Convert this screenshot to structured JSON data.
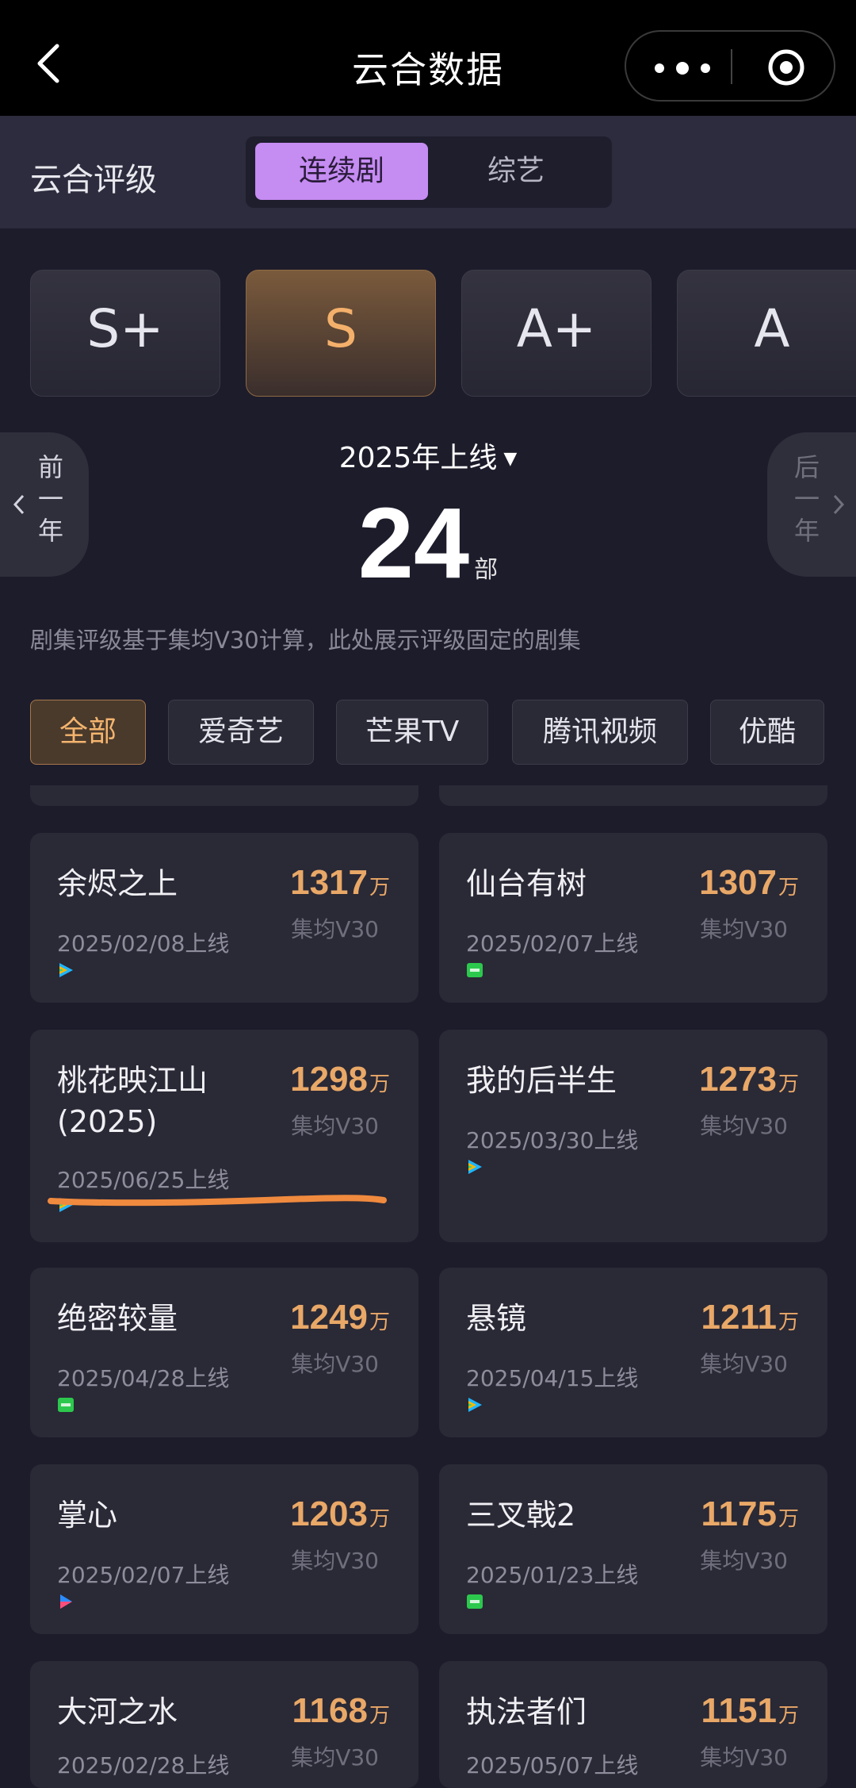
{
  "nav": {
    "title": "云合数据"
  },
  "header": {
    "rating_title": "云合评级",
    "tabs": [
      {
        "label": "连续剧",
        "active": true
      },
      {
        "label": "综艺",
        "active": false
      }
    ]
  },
  "grades": [
    {
      "label": "S+",
      "active": false
    },
    {
      "label": "S",
      "active": true
    },
    {
      "label": "A+",
      "active": false
    },
    {
      "label": "A",
      "active": false
    }
  ],
  "year": {
    "prev_label": [
      "前",
      "一",
      "年"
    ],
    "next_label": [
      "后",
      "一",
      "年"
    ],
    "selected": "2025年上线",
    "count": "24",
    "count_unit": "部"
  },
  "note": "剧集评级基于集均V30计算，此处展示评级固定的剧集",
  "platforms": [
    {
      "label": "全部",
      "active": true
    },
    {
      "label": "爱奇艺",
      "active": false
    },
    {
      "label": "芒果TV",
      "active": false
    },
    {
      "label": "腾讯视频",
      "active": false
    },
    {
      "label": "优酷",
      "active": false
    }
  ],
  "shows": [
    {
      "name": "余烬之上",
      "date": "2025/02/08上线",
      "score": "1317",
      "unit": "万",
      "metric": "集均V30",
      "platform_icon": "tencent-video-icon"
    },
    {
      "name": "仙台有树",
      "date": "2025/02/07上线",
      "score": "1307",
      "unit": "万",
      "metric": "集均V30",
      "platform_icon": "iqiyi-icon"
    },
    {
      "name": "桃花映江山",
      "name2": "(2025)",
      "date": "2025/06/25上线",
      "score": "1298",
      "unit": "万",
      "metric": "集均V30",
      "platform_icon": "tencent-video-icon"
    },
    {
      "name": "我的后半生",
      "date": "2025/03/30上线",
      "score": "1273",
      "unit": "万",
      "metric": "集均V30",
      "platform_icon": "tencent-video-icon"
    },
    {
      "name": "绝密较量",
      "date": "2025/04/28上线",
      "score": "1249",
      "unit": "万",
      "metric": "集均V30",
      "platform_icon": "iqiyi-icon"
    },
    {
      "name": "悬镜",
      "date": "2025/04/15上线",
      "score": "1211",
      "unit": "万",
      "metric": "集均V30",
      "platform_icon": "tencent-video-icon"
    },
    {
      "name": "掌心",
      "date": "2025/02/07上线",
      "score": "1203",
      "unit": "万",
      "metric": "集均V30",
      "platform_icon": "youku-icon"
    },
    {
      "name": "三叉戟2",
      "date": "2025/01/23上线",
      "score": "1175",
      "unit": "万",
      "metric": "集均V30",
      "platform_icon": "iqiyi-icon"
    },
    {
      "name": "大河之水",
      "date": "2025/02/28上线",
      "score": "1168",
      "unit": "万",
      "metric": "集均V30",
      "platform_icon": ""
    },
    {
      "name": "执法者们",
      "date": "2025/05/07上线",
      "score": "1151",
      "unit": "万",
      "metric": "集均V30",
      "platform_icon": ""
    }
  ],
  "colors": {
    "accent_purple": "#c58cf2",
    "accent_orange": "#e9a867",
    "highlight_stroke": "#f08a3e",
    "background": "#1d1c2b"
  }
}
